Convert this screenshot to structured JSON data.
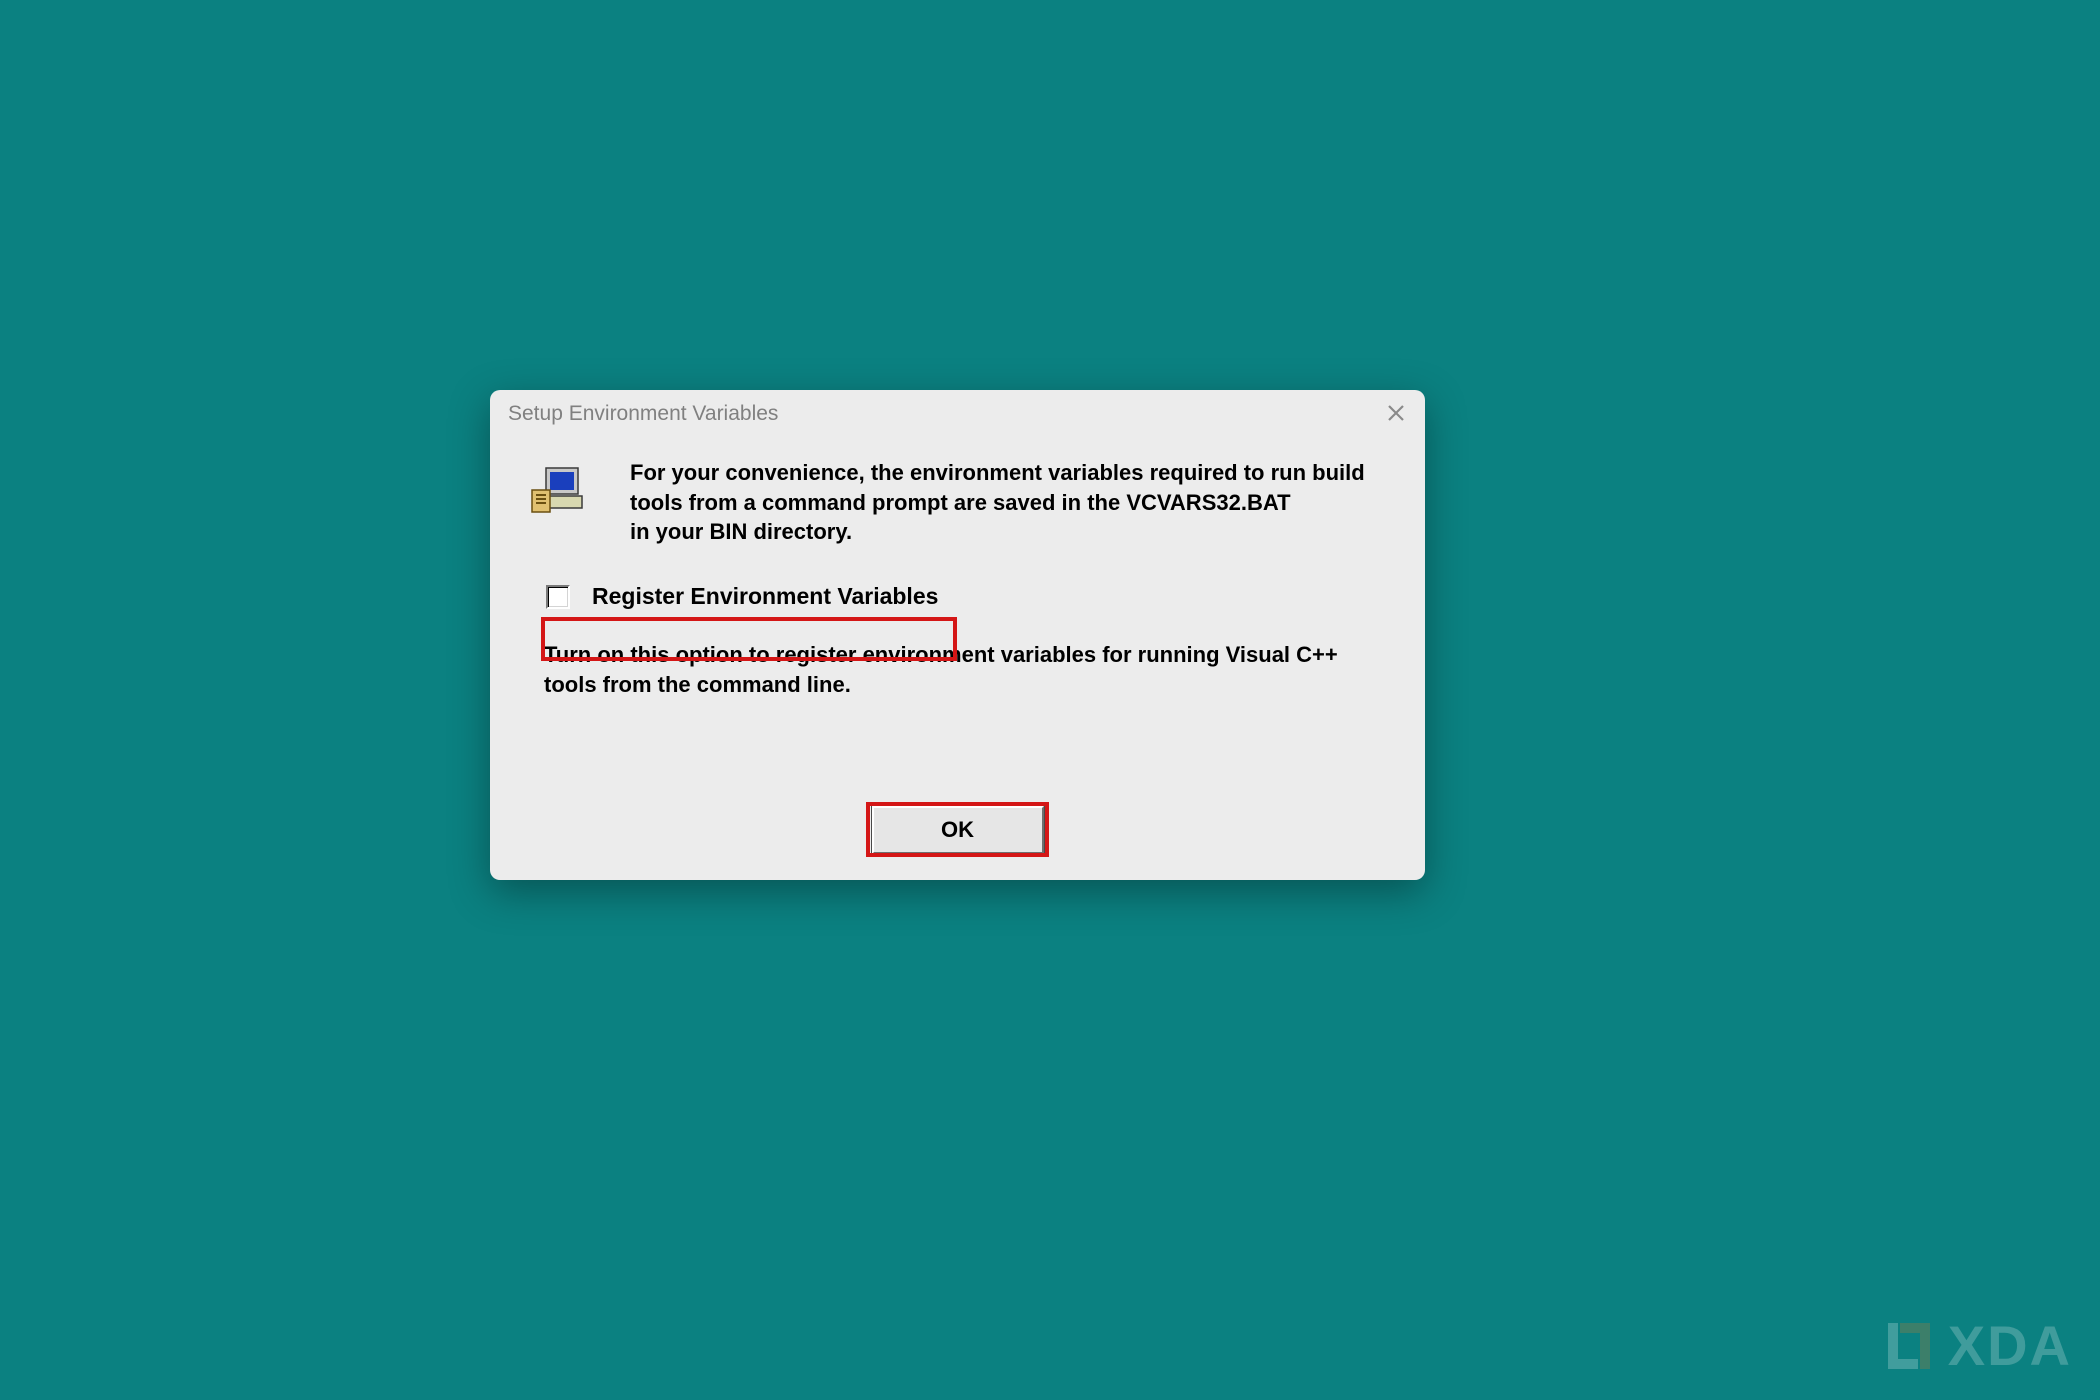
{
  "dialog": {
    "title": "Setup Environment Variables",
    "message_line1": "For your convenience, the environment variables required to run build tools from a command prompt are saved in the VCVARS32.BAT",
    "message_line2": "in your BIN directory.",
    "checkbox_label": "Register Environment Variables",
    "checkbox_checked": false,
    "explain": "Turn on this option to register environment variables for running Visual C++ tools from the command line.",
    "ok_label": "OK"
  },
  "watermark": "XDA"
}
